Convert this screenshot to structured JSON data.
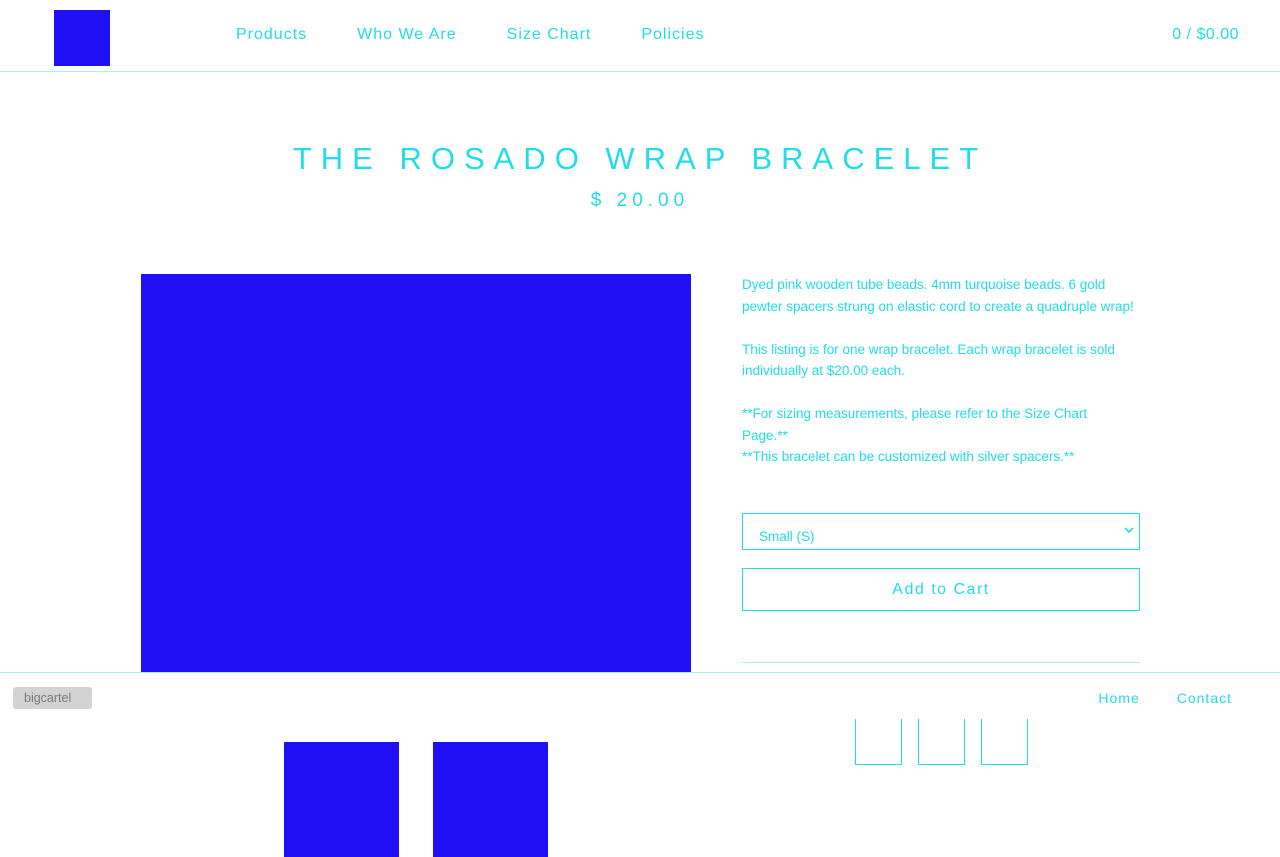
{
  "header": {
    "nav": [
      "Products",
      "Who We Are",
      "Size Chart",
      "Policies"
    ],
    "cart": "0 / $0.00"
  },
  "product": {
    "title": "THE ROSADO WRAP BRACELET",
    "price": "$ 20.00",
    "description": [
      "Dyed pink wooden tube beads. 4mm turquoise beads. 6 gold pewter spacers strung on elastic cord to create a quadruple wrap!",
      "This listing is for one wrap bracelet. Each wrap bracelet is sold individually at $20.00 each.",
      "**For sizing measurements, please refer to the Size Chart Page.**",
      "**This bracelet can be customized with silver spacers.**"
    ],
    "size_selected": "Small (S)",
    "add_to_cart": "Add to Cart"
  },
  "footer": {
    "badge": "bigcartel",
    "nav": [
      "Home",
      "Contact"
    ]
  },
  "colors": {
    "accent": "#22dde6",
    "image_placeholder": "#1f10f5",
    "divider": "#a9eef2",
    "badge_bg": "#d3d3d3"
  },
  "icons": {
    "select": "chevron-down-icon"
  }
}
